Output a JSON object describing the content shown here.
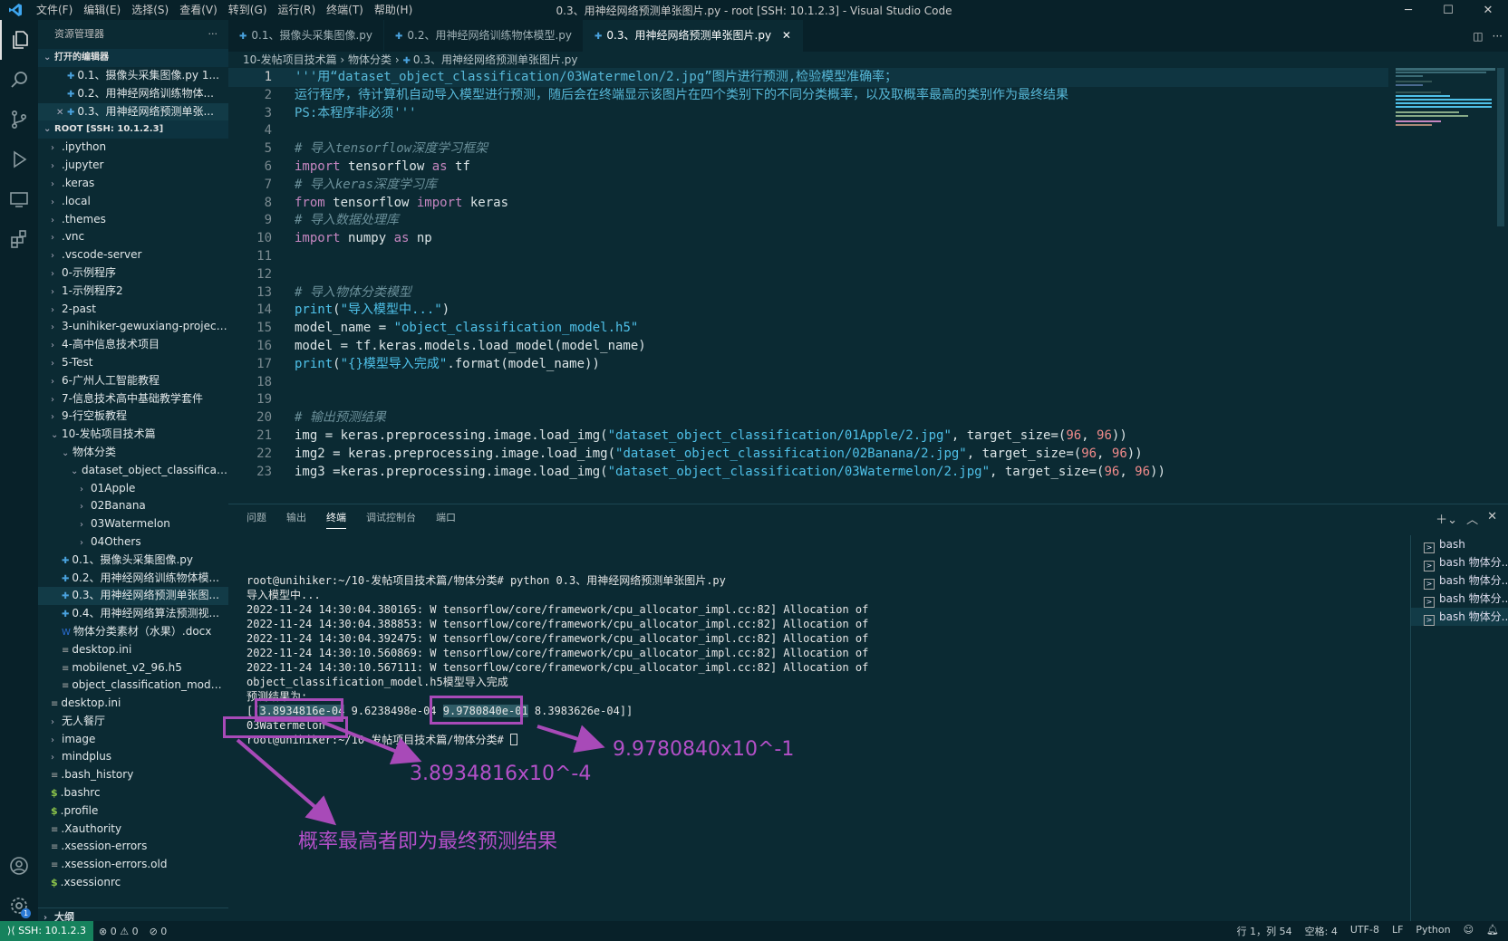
{
  "titlebar": {
    "menu": [
      "文件(F)",
      "编辑(E)",
      "选择(S)",
      "查看(V)",
      "转到(G)",
      "运行(R)",
      "终端(T)",
      "帮助(H)"
    ],
    "title": "0.3、用神经网络预测单张图片.py - root [SSH: 10.1.2.3] - Visual Studio Code"
  },
  "sidebar": {
    "header": "资源管理器",
    "open_editors_label": "打开的编辑器",
    "open_editors": [
      "0.1、摄像头采集图像.py 1...",
      "0.2、用神经网络训练物体...",
      "0.3、用神经网络预测单张..."
    ],
    "root_label": "ROOT [SSH: 10.1.2.3]",
    "tree": [
      {
        "label": ".ipython",
        "type": "folder"
      },
      {
        "label": ".jupyter",
        "type": "folder"
      },
      {
        "label": ".keras",
        "type": "folder"
      },
      {
        "label": ".local",
        "type": "folder"
      },
      {
        "label": ".themes",
        "type": "folder"
      },
      {
        "label": ".vnc",
        "type": "folder"
      },
      {
        "label": ".vscode-server",
        "type": "folder"
      },
      {
        "label": "0-示例程序",
        "type": "folder"
      },
      {
        "label": "1-示例程序2",
        "type": "folder"
      },
      {
        "label": "2-past",
        "type": "folder"
      },
      {
        "label": "3-unihiker-gewuxiang-projects-...",
        "type": "folder"
      },
      {
        "label": "4-高中信息技术项目",
        "type": "folder"
      },
      {
        "label": "5-Test",
        "type": "folder"
      },
      {
        "label": "6-广州人工智能教程",
        "type": "folder"
      },
      {
        "label": "7-信息技术高中基础教学套件",
        "type": "folder"
      },
      {
        "label": "9-行空板教程",
        "type": "folder"
      },
      {
        "label": "10-发帖项目技术篇",
        "type": "folder-open"
      },
      {
        "label": "物体分类",
        "type": "folder-open"
      },
      {
        "label": "dataset_object_classification",
        "type": "folder-open"
      },
      {
        "label": "01Apple",
        "type": "folder"
      },
      {
        "label": "02Banana",
        "type": "folder"
      },
      {
        "label": "03Watermelon",
        "type": "folder"
      },
      {
        "label": "04Others",
        "type": "folder"
      },
      {
        "label": "0.1、摄像头采集图像.py",
        "type": "py"
      },
      {
        "label": "0.2、用神经网络训练物体模...",
        "type": "py"
      },
      {
        "label": "0.3、用神经网络预测单张图...",
        "type": "py"
      },
      {
        "label": "0.4、用神经网络算法预测视...",
        "type": "py"
      },
      {
        "label": "物体分类素材（水果）.docx",
        "type": "doc"
      },
      {
        "label": "desktop.ini",
        "type": "file"
      },
      {
        "label": "mobilenet_v2_96.h5",
        "type": "file"
      },
      {
        "label": "object_classification_model.h5",
        "type": "file"
      },
      {
        "label": "desktop.ini",
        "type": "file"
      },
      {
        "label": "无人餐厅",
        "type": "folder"
      },
      {
        "label": "image",
        "type": "folder"
      },
      {
        "label": "mindplus",
        "type": "folder"
      },
      {
        "label": ".bash_history",
        "type": "file"
      },
      {
        "label": ".bashrc",
        "type": "dollar"
      },
      {
        "label": ".profile",
        "type": "dollar"
      },
      {
        "label": ".Xauthority",
        "type": "file"
      },
      {
        "label": ".xsession-errors",
        "type": "file"
      },
      {
        "label": ".xsession-errors.old",
        "type": "file"
      },
      {
        "label": ".xsessionrc",
        "type": "dollar"
      }
    ],
    "outline_label": "大纲"
  },
  "tabs": [
    "0.1、摄像头采集图像.py",
    "0.2、用神经网络训练物体模型.py",
    "0.3、用神经网络预测单张图片.py"
  ],
  "breadcrumb": [
    "10-发帖项目技术篇",
    "物体分类",
    "0.3、用神经网络预测单张图片.py"
  ],
  "editor": {
    "lines": [
      "'''用“dataset_object_classification/03Watermelon/2.jpg”图片进行预测,检验模型准确率；",
      "运行程序，待计算机自动导入模型进行预测，随后会在终端显示该图片在四个类别下的不同分类概率，以及取概率最高的类别作为最终结果",
      "PS:本程序非必须'''",
      "",
      "# 导入tensorflow深度学习框架",
      "import tensorflow as tf",
      "# 导入keras深度学习库",
      "from tensorflow import keras",
      "# 导入数据处理库",
      "import numpy as np",
      "",
      "",
      "# 导入物体分类模型",
      "print(\"导入模型中...\")",
      "model_name = \"object_classification_model.h5\"",
      "model = tf.keras.models.load_model(model_name)",
      "print(\"{}模型导入完成\".format(model_name))",
      "",
      "",
      "# 输出预测结果",
      "img = keras.preprocessing.image.load_img(\"dataset_object_classification/01Apple/2.jpg\", target_size=(96, 96))",
      "img2 = keras.preprocessing.image.load_img(\"dataset_object_classification/02Banana/2.jpg\", target_size=(96, 96))",
      "img3 =keras.preprocessing.image.load_img(\"dataset_object_classification/03Watermelon/2.jpg\", target_size=(96, 96))"
    ]
  },
  "panel": {
    "tabs": [
      "问题",
      "输出",
      "终端",
      "调试控制台",
      "端口"
    ],
    "terminal_lines": [
      "root@unihiker:~/10-发帖项目技术篇/物体分类# python 0.3、用神经网络预测单张图片.py",
      "导入模型中...",
      "2022-11-24 14:30:04.380165: W tensorflow/core/framework/cpu_allocator_impl.cc:82] Allocation of",
      "2022-11-24 14:30:04.388853: W tensorflow/core/framework/cpu_allocator_impl.cc:82] Allocation of",
      "2022-11-24 14:30:04.392475: W tensorflow/core/framework/cpu_allocator_impl.cc:82] Allocation of",
      "2022-11-24 14:30:10.560869: W tensorflow/core/framework/cpu_allocator_impl.cc:82] Allocation of",
      "2022-11-24 14:30:10.567111: W tensorflow/core/framework/cpu_allocator_impl.cc:82] Allocation of",
      "object_classification_model.h5模型导入完成",
      "预测结果为:",
      "[[3.8934816e-04 9.6238498e-04 9.9780840e-01 8.3983626e-04]]",
      "03Watermelon",
      "root@unihiker:~/10-发帖项目技术篇/物体分类# "
    ],
    "terminals": [
      "bash",
      "bash 物体分...",
      "bash 物体分...",
      "bash 物体分...",
      "bash 物体分..."
    ]
  },
  "annotations": {
    "value1": "3.8934816x10^-4",
    "value2": "9.9780840x10^-1",
    "conclusion": "概率最高者即为最终预测结果",
    "color": "#a84ab8"
  },
  "statusbar": {
    "remote": "SSH: 10.1.2.3",
    "problems": "⊗ 0 ⚠ 0",
    "ports": "⊘ 0",
    "position": "行 1，列 54",
    "spaces": "空格: 4",
    "encoding": "UTF-8",
    "eol": "LF",
    "language": "Python",
    "badge": "1"
  }
}
